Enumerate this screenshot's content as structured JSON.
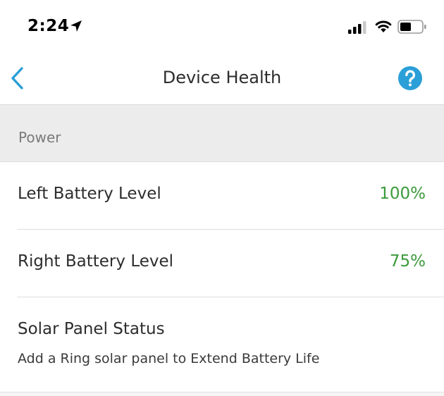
{
  "status_bar": {
    "time": "2:24",
    "icons": [
      "location-arrow-icon",
      "cellular-signal-icon",
      "wifi-icon",
      "battery-icon"
    ]
  },
  "nav": {
    "title": "Device Health",
    "back_icon": "chevron-left-icon",
    "help_icon": "help-icon",
    "accent_color": "#2a9fd8"
  },
  "sections": [
    {
      "title": "Power",
      "rows": [
        {
          "label": "Left Battery Level",
          "value": "100%"
        },
        {
          "label": "Right Battery Level",
          "value": "75%"
        },
        {
          "label": "Solar Panel Status",
          "subtitle": "Add a Ring solar panel to Extend Battery Life"
        }
      ]
    }
  ],
  "colors": {
    "value_green": "#3c9a3c",
    "section_bg": "#ececec"
  }
}
